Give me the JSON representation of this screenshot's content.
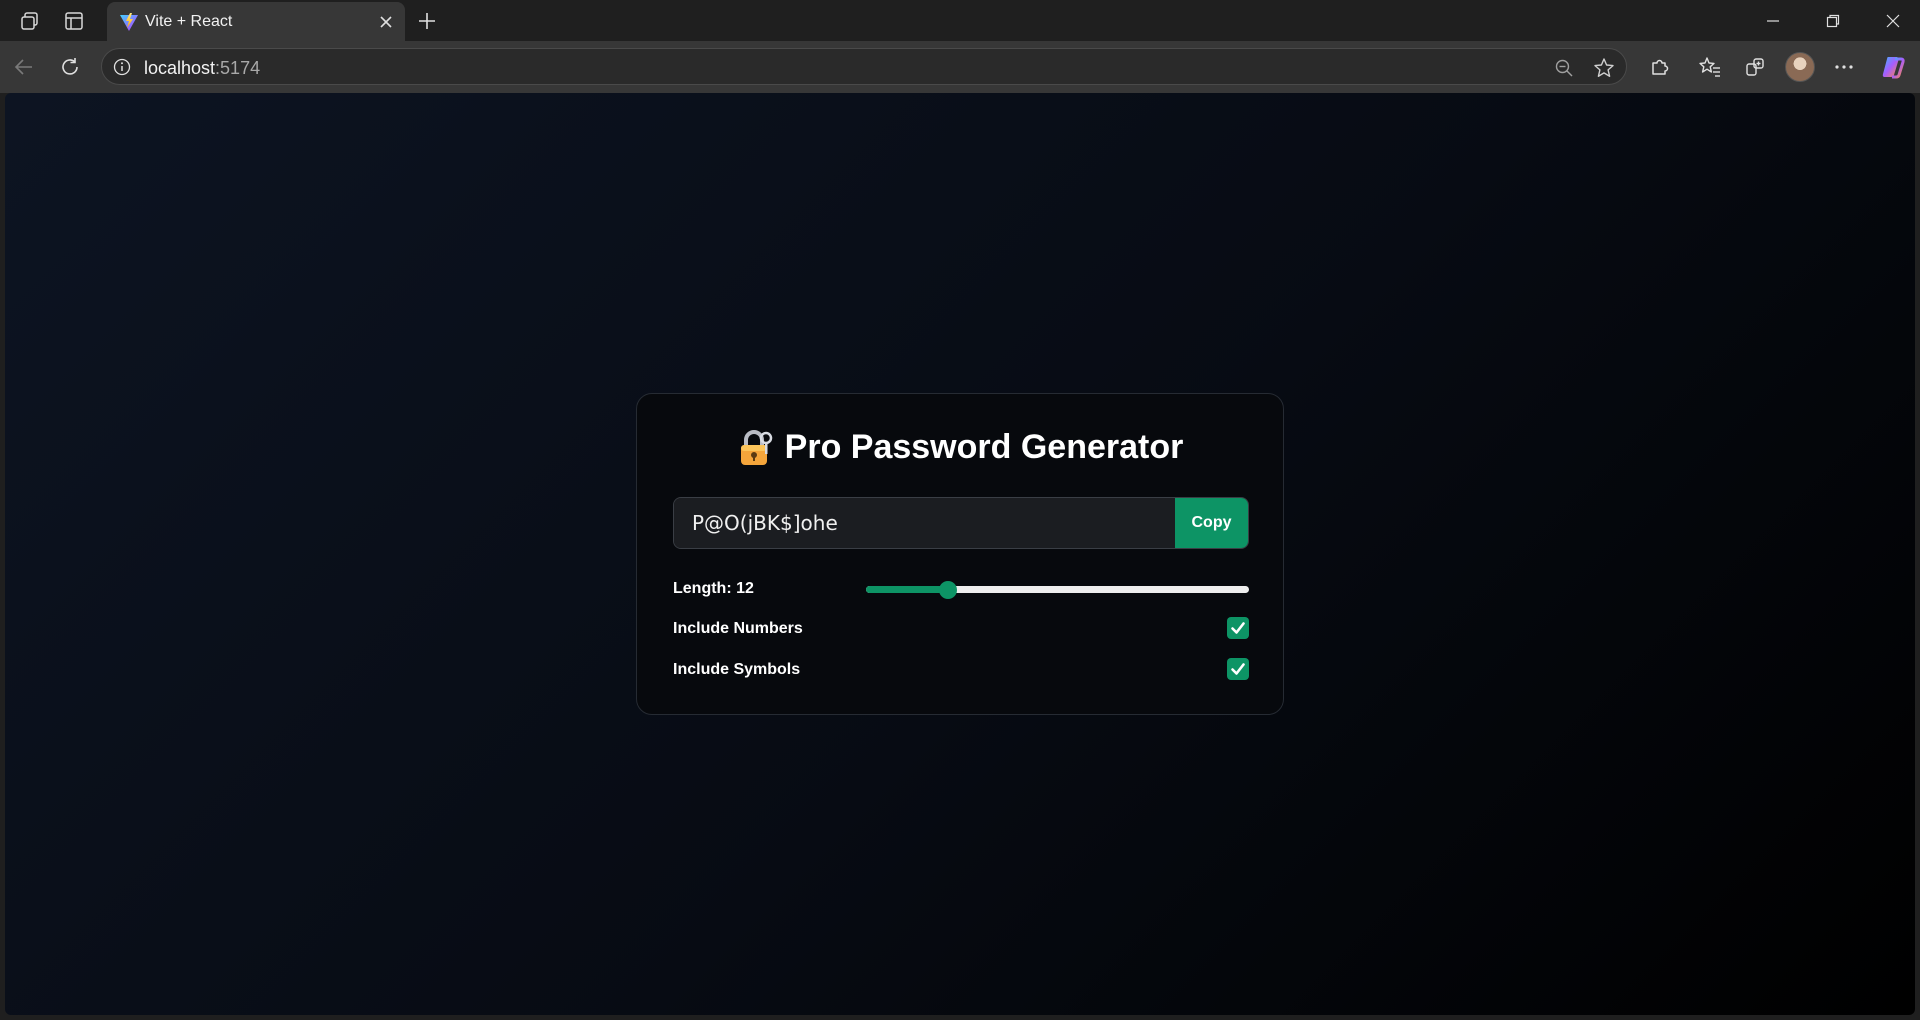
{
  "browser": {
    "tab": {
      "title": "Vite + React",
      "favicon": "vite-logo-icon"
    },
    "address_bar": {
      "host": "localhost",
      "port": ":5174"
    },
    "icons": {
      "workspaces": "workspaces-icon",
      "tab_actions": "tab-actions-icon",
      "close_tab": "close-icon",
      "new_tab": "plus-icon",
      "minimize": "minimize-icon",
      "restore": "restore-icon",
      "close_window": "close-icon",
      "back": "back-arrow-icon",
      "refresh": "refresh-icon",
      "site_info": "info-icon",
      "zoom": "zoom-out-icon",
      "favorite": "star-icon",
      "extensions": "puzzle-icon",
      "favorites": "favorites-icon",
      "collections": "collections-icon",
      "profile": "avatar",
      "more": "more-icon",
      "copilot": "copilot-icon"
    }
  },
  "app": {
    "title": "Pro Password Generator",
    "title_icon": "lock-icon",
    "password": "P@O(jBK$]ohe",
    "copy_label": "Copy",
    "length_label": "Length: 12",
    "length": {
      "value": 12,
      "min": 6,
      "max": 36
    },
    "include_numbers_label": "Include Numbers",
    "include_numbers": true,
    "include_symbols_label": "Include Symbols",
    "include_symbols": true,
    "colors": {
      "accent": "#0d9465",
      "card_bg": "#07090d",
      "page_bg": "#0d1422"
    }
  }
}
